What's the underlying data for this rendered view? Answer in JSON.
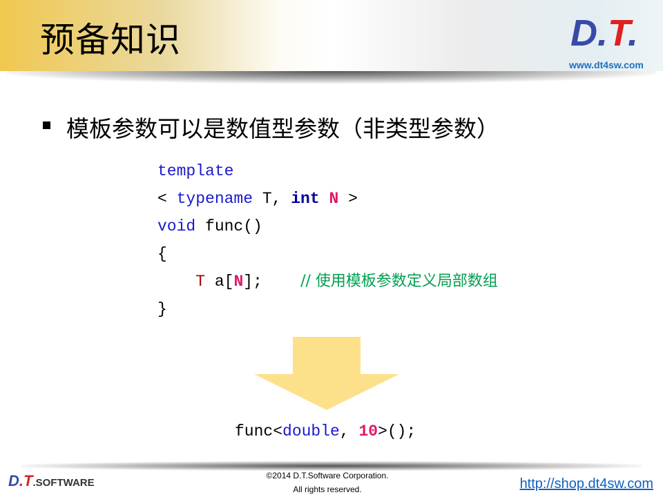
{
  "header": {
    "title": "预备知识",
    "logo_d": "D",
    "logo_dot": ".",
    "logo_t": "T",
    "logo_dot2": ".",
    "url": "www.dt4sw.com"
  },
  "bullet": {
    "text": "模板参数可以是数值型参数（非类型参数）"
  },
  "code": {
    "lines": [
      [
        {
          "text": "template",
          "kind": "k"
        }
      ],
      [
        {
          "text": "< ",
          "kind": ""
        },
        {
          "text": "typename",
          "kind": "k"
        },
        {
          "text": " T, ",
          "kind": ""
        },
        {
          "text": "int",
          "kind": "kb"
        },
        {
          "text": " ",
          "kind": ""
        },
        {
          "text": "N",
          "kind": "n"
        },
        {
          "text": " >",
          "kind": ""
        }
      ],
      [
        {
          "text": "void",
          "kind": "k"
        },
        {
          "text": " func()",
          "kind": ""
        }
      ],
      [
        {
          "text": "{",
          "kind": ""
        }
      ],
      [
        {
          "text": "    ",
          "kind": ""
        },
        {
          "text": "T",
          "kind": "t"
        },
        {
          "text": " a[",
          "kind": ""
        },
        {
          "text": "N",
          "kind": "n"
        },
        {
          "text": "];    ",
          "kind": ""
        },
        {
          "text": "// ",
          "kind": "c"
        },
        {
          "text": "使用模板参数定义局部数组",
          "kind": "c"
        }
      ],
      [
        {
          "text": "}",
          "kind": ""
        }
      ]
    ]
  },
  "call": [
    {
      "text": "func<",
      "kind": ""
    },
    {
      "text": "double",
      "kind": "k"
    },
    {
      "text": ", ",
      "kind": ""
    },
    {
      "text": "10",
      "kind": "n"
    },
    {
      "text": ">();",
      "kind": ""
    }
  ],
  "footer": {
    "logo_d": "D",
    "logo_t": ".T",
    "logo_sw": ".SOFTWARE",
    "copyright": "©2014 D.T.Software Corporation.",
    "rights": "All rights reserved.",
    "link": "http://shop.dt4sw.com"
  },
  "colors": {
    "arrow": "#fde08a",
    "keyword": "#1a1ad0",
    "number": "#e0186a",
    "comment": "#00a050"
  }
}
